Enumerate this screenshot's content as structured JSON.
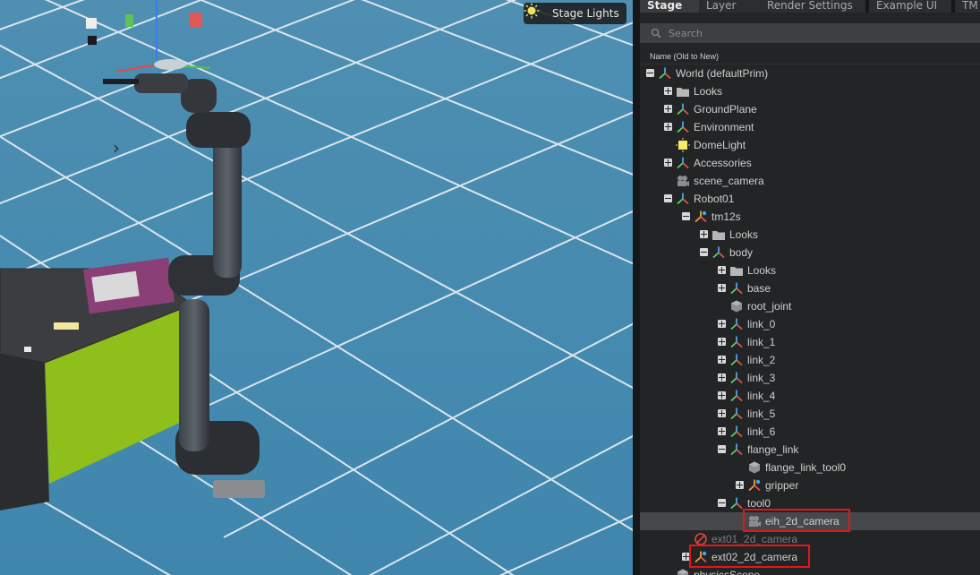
{
  "viewport": {
    "stage_lights_label": "Stage Lights"
  },
  "panel": {
    "tabs": [
      {
        "label": "Stage",
        "active": true
      },
      {
        "label": "Layer",
        "active": false
      },
      {
        "label": "Render Settings",
        "active": false
      },
      {
        "label": "Example UI",
        "active": false
      },
      {
        "label": "TM",
        "active": false
      }
    ],
    "search_placeholder": "Search",
    "column_header": "Name (Old to New)",
    "tree": [
      {
        "label": "World (defaultPrim)",
        "icon": "xform-icon",
        "toggle": "minus",
        "depth": 0
      },
      {
        "label": "Looks",
        "icon": "folder-icon",
        "toggle": "plus",
        "depth": 1
      },
      {
        "label": "GroundPlane",
        "icon": "xform-icon",
        "toggle": "plus",
        "depth": 1
      },
      {
        "label": "Environment",
        "icon": "xform-icon",
        "toggle": "plus",
        "depth": 1
      },
      {
        "label": "DomeLight",
        "icon": "light-icon",
        "toggle": "",
        "depth": 1
      },
      {
        "label": "Accessories",
        "icon": "xform-icon",
        "toggle": "plus",
        "depth": 1
      },
      {
        "label": "scene_camera",
        "icon": "camera-icon",
        "toggle": "",
        "depth": 1
      },
      {
        "label": "Robot01",
        "icon": "xform-icon",
        "toggle": "minus",
        "depth": 1
      },
      {
        "label": "tm12s",
        "icon": "articulation-icon",
        "toggle": "minus",
        "depth": 2
      },
      {
        "label": "Looks",
        "icon": "folder-icon",
        "toggle": "plus",
        "depth": 3
      },
      {
        "label": "body",
        "icon": "xform-icon",
        "toggle": "minus",
        "depth": 3
      },
      {
        "label": "Looks",
        "icon": "folder-icon",
        "toggle": "plus",
        "depth": 4
      },
      {
        "label": "base",
        "icon": "xform-icon",
        "toggle": "plus",
        "depth": 4
      },
      {
        "label": "root_joint",
        "icon": "cube-icon",
        "toggle": "",
        "depth": 4
      },
      {
        "label": "link_0",
        "icon": "xform-icon",
        "toggle": "plus",
        "depth": 4
      },
      {
        "label": "link_1",
        "icon": "xform-icon",
        "toggle": "plus",
        "depth": 4
      },
      {
        "label": "link_2",
        "icon": "xform-icon",
        "toggle": "plus",
        "depth": 4
      },
      {
        "label": "link_3",
        "icon": "xform-icon",
        "toggle": "plus",
        "depth": 4
      },
      {
        "label": "link_4",
        "icon": "xform-icon",
        "toggle": "plus",
        "depth": 4
      },
      {
        "label": "link_5",
        "icon": "xform-icon",
        "toggle": "plus",
        "depth": 4
      },
      {
        "label": "link_6",
        "icon": "xform-icon",
        "toggle": "plus",
        "depth": 4
      },
      {
        "label": "flange_link",
        "icon": "xform-icon",
        "toggle": "minus",
        "depth": 4
      },
      {
        "label": "flange_link_tool0",
        "icon": "cube-icon",
        "toggle": "",
        "depth": 5
      },
      {
        "label": "gripper",
        "icon": "articulation-icon",
        "toggle": "plus",
        "depth": 5
      },
      {
        "label": "tool0",
        "icon": "xform-icon",
        "toggle": "minus",
        "depth": 4
      },
      {
        "label": "eih_2d_camera",
        "icon": "camera-icon",
        "toggle": "",
        "depth": 5,
        "selected": true,
        "highlighted": true
      },
      {
        "label": "ext01_2d_camera",
        "icon": "disabled-icon",
        "toggle": "",
        "depth": 2,
        "dim": true
      },
      {
        "label": "ext02_2d_camera",
        "icon": "articulation-icon",
        "toggle": "plus",
        "depth": 2,
        "highlighted": true
      },
      {
        "label": "physicsScene",
        "icon": "cube-icon",
        "toggle": "",
        "depth": 1
      }
    ]
  },
  "colors": {
    "highlight_box": "#e3161b",
    "floor_tile": "#4f93b7",
    "table_side": "#8fbf1a"
  }
}
